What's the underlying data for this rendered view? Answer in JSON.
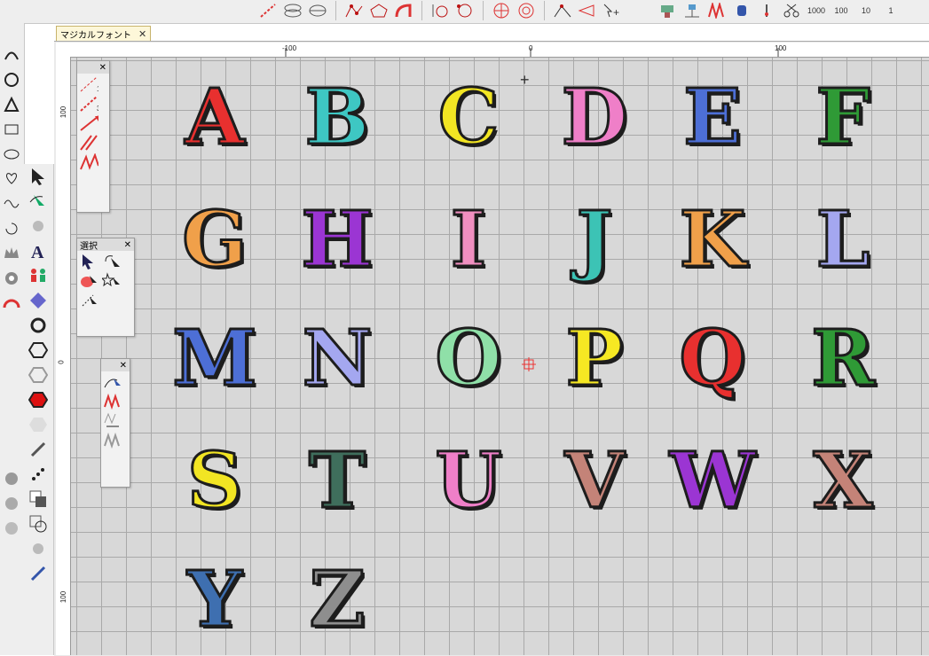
{
  "window": {
    "tab_title": "マジカルフォント",
    "tab_close": "✕"
  },
  "toolbar": {
    "labels": [
      "1000",
      "100",
      "10",
      "1"
    ]
  },
  "rulers": {
    "h_labels": [
      "-100",
      "0",
      "100"
    ],
    "v_labels": [
      "100",
      "0",
      "100"
    ]
  },
  "palettes": {
    "stitch": {
      "close": "✕",
      "items": [
        "1",
        "3"
      ]
    },
    "select": {
      "title": "選択",
      "close": "✕"
    },
    "edit": {
      "close": "✕"
    }
  },
  "letters": [
    {
      "char": "A",
      "color": "#e8302f"
    },
    {
      "char": "B",
      "color": "#3ec7c3"
    },
    {
      "char": "C",
      "color": "#f2e523"
    },
    {
      "char": "D",
      "color": "#ef7fc8"
    },
    {
      "char": "E",
      "color": "#4d6fd6"
    },
    {
      "char": "F",
      "color": "#2f9a36"
    },
    {
      "char": "G",
      "color": "#f0a04a"
    },
    {
      "char": "H",
      "color": "#9b35d3"
    },
    {
      "char": "I",
      "color": "#f08fc0"
    },
    {
      "char": "J",
      "color": "#3cc3b5"
    },
    {
      "char": "K",
      "color": "#f0a04a"
    },
    {
      "char": "L",
      "color": "#a4a7f0"
    },
    {
      "char": "M",
      "color": "#4d6fd6"
    },
    {
      "char": "N",
      "color": "#a4a7f0"
    },
    {
      "char": "O",
      "color": "#8fe0a8"
    },
    {
      "char": "P",
      "color": "#f6e823"
    },
    {
      "char": "Q",
      "color": "#e8302f"
    },
    {
      "char": "R",
      "color": "#2f9a36"
    },
    {
      "char": "S",
      "color": "#f2e523"
    },
    {
      "char": "T",
      "color": "#3f6e5c"
    },
    {
      "char": "U",
      "color": "#ef7fc8"
    },
    {
      "char": "V",
      "color": "#c48378"
    },
    {
      "char": "W",
      "color": "#9b35d3"
    },
    {
      "char": "X",
      "color": "#c48378"
    },
    {
      "char": "Y",
      "color": "#3e6fb0"
    },
    {
      "char": "Z",
      "color": "#8e8e8e"
    }
  ],
  "icons": {
    "cursor": "crosshair-icon",
    "origin": "origin-marker-icon"
  }
}
